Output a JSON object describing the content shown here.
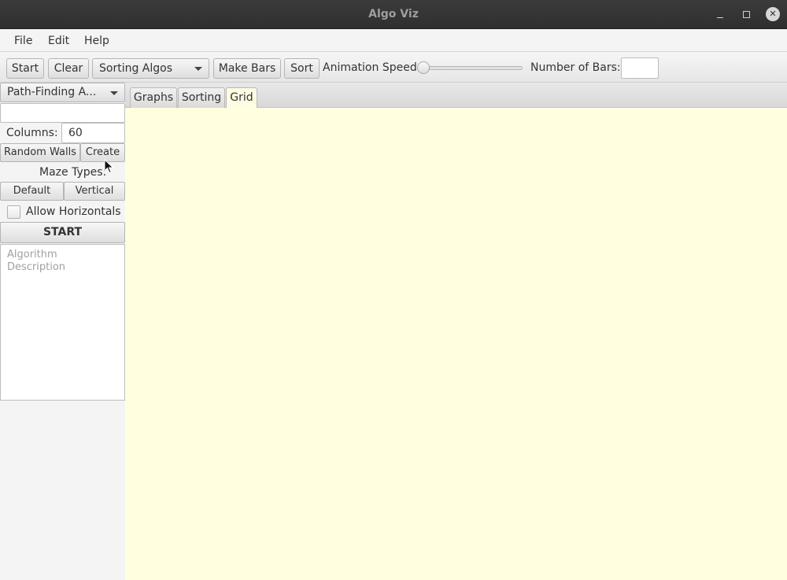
{
  "window": {
    "title": "Algo Viz"
  },
  "menubar": {
    "items": [
      "File",
      "Edit",
      "Help"
    ]
  },
  "toolbar": {
    "start_label": "Start",
    "clear_label": "Clear",
    "algorithm_select": {
      "selected": "Sorting Algos"
    },
    "make_bars_label": "Make Bars",
    "sort_label": "Sort",
    "animation_speed_label": "Animation Speed:",
    "animation_speed_value": 0,
    "number_of_bars_label": "Number of Bars:",
    "number_of_bars_value": ""
  },
  "sidebar": {
    "pathfinding_select": {
      "selected": "Path-Finding A..."
    },
    "rows_value": "",
    "columns_label": "Columns:",
    "columns_value": "60",
    "random_walls_label": "Random Walls",
    "create_label": "Create",
    "maze_types_label": "Maze Types:",
    "default_label": "Default",
    "vertical_label": "Vertical",
    "allow_horizontals_label": "Allow Horizontals",
    "allow_horizontals_checked": false,
    "start_label": "START",
    "description_placeholder": "Algorithm Description"
  },
  "tabs": [
    {
      "label": "Graphs",
      "active": false
    },
    {
      "label": "Sorting",
      "active": false
    },
    {
      "label": "Grid",
      "active": true
    }
  ],
  "colors": {
    "canvas": "#ffffe0",
    "titlebar": "#2f2f2f"
  },
  "icons": [
    "minimize-icon",
    "maximize-icon",
    "close-icon",
    "chevron-down-icon",
    "mouse-cursor-icon"
  ]
}
